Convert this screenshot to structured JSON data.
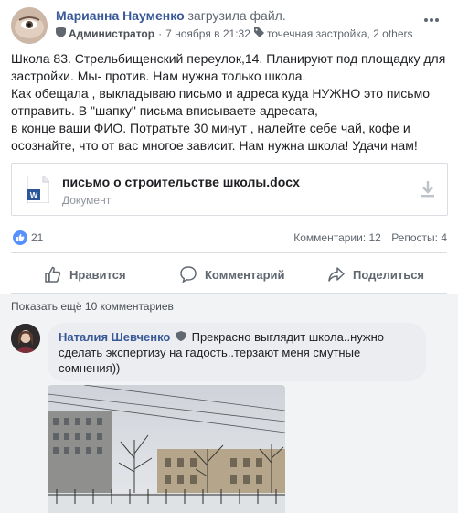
{
  "post": {
    "author": "Марианна Науменко",
    "action": "загрузила файл.",
    "role": "Администратор",
    "date": "7 ноября в 21:32",
    "tags": "точечная застройка, 2 others",
    "text_lines": [
      "Школа 83. Стрельбищенский переулок,14. Планируют под площадку для",
      "застройки. Мы- против. Нам нужна только школа.",
      "Как обещала , выкладываю письмо и адреса куда НУЖНО это письмо",
      "отправить. В \"шапку\" письма вписываете адресата,",
      "в конце ваши ФИО. Потратьте 30 минут , налейте себе чай, кофе и",
      "осознайте, что от вас многое зависит. Нам нужна школа! Удачи нам!"
    ]
  },
  "attachment": {
    "title": "письмо о строительстве школы.docx",
    "subtitle": "Документ",
    "icon_letter": "W"
  },
  "stats": {
    "likes": "21",
    "comments": "Комментарии: 12",
    "shares": "Репосты: 4"
  },
  "actions": {
    "like": "Нравится",
    "comment": "Комментарий",
    "share": "Поделиться"
  },
  "comments": {
    "show_more": "Показать ещё 10 комментариев",
    "items": [
      {
        "author": "Наталия Шевченко",
        "line1": "Прекрасно выглядит школа..нужно",
        "line2": "сделать экспертизу на гадость..терзают меня смутные",
        "line3": "сомнения))"
      }
    ]
  },
  "colors": {
    "link": "#385898",
    "like_blue": "#5890ff",
    "word_blue": "#2b579a"
  }
}
